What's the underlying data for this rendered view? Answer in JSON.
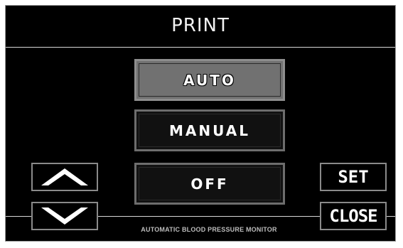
{
  "screen": {
    "title": "PRINT",
    "footer": "AUTOMATIC BLOOD PRESSURE MONITOR"
  },
  "modes": {
    "auto_label": "Auto",
    "manual_label": "Manual",
    "off_label": "Off",
    "selected": "Auto"
  },
  "controls": {
    "up_icon": "chevron-up-icon",
    "down_icon": "chevron-down-icon",
    "set_label": "SET",
    "close_label": "CLOSE"
  },
  "colors": {
    "background": "#000000",
    "selected_button": "#717171",
    "border": "#8a8a8a",
    "text": "#ffffff"
  }
}
